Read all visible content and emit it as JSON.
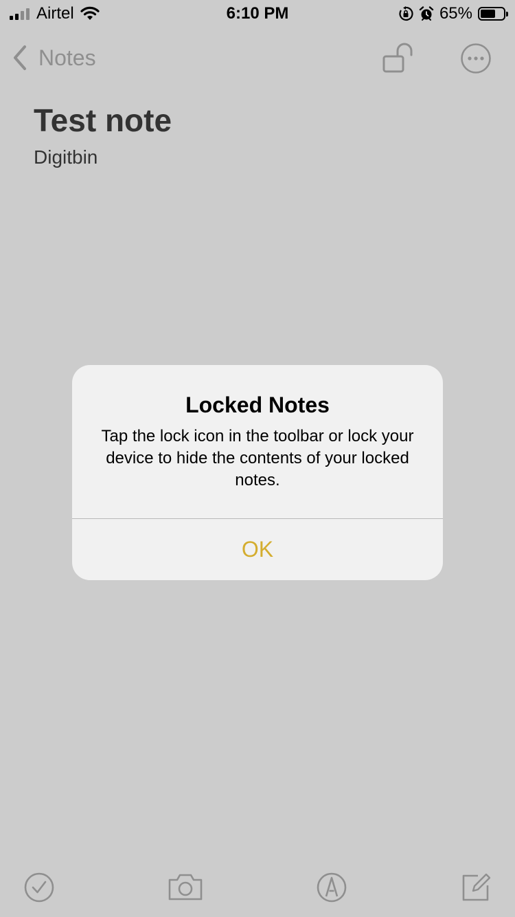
{
  "status_bar": {
    "carrier": "Airtel",
    "time": "6:10 PM",
    "battery_percent": "65%",
    "battery_level": 0.65,
    "signal_bars": 2,
    "signal_total": 4,
    "icons": [
      "signal-icon",
      "wifi-icon",
      "orientation-lock-icon",
      "alarm-icon",
      "battery-icon"
    ]
  },
  "nav": {
    "back_label": "Notes",
    "icons": [
      "chevron-left-icon",
      "unlocked-lock-icon",
      "more-options-icon"
    ]
  },
  "note": {
    "title": "Test note",
    "body": "Digitbin"
  },
  "alert": {
    "title": "Locked Notes",
    "message": "Tap the lock icon in the toolbar or lock your device to hide the contents of your locked notes.",
    "ok_label": "OK",
    "ok_color": "#d4ad2f"
  },
  "toolbar": {
    "icons": [
      "checklist-icon",
      "camera-icon",
      "markup-icon",
      "compose-icon"
    ]
  },
  "colors": {
    "dimmed_background": "#cccccc",
    "alert_background": "#f1f1f1",
    "dimmed_icon": "#8f8f8f"
  }
}
